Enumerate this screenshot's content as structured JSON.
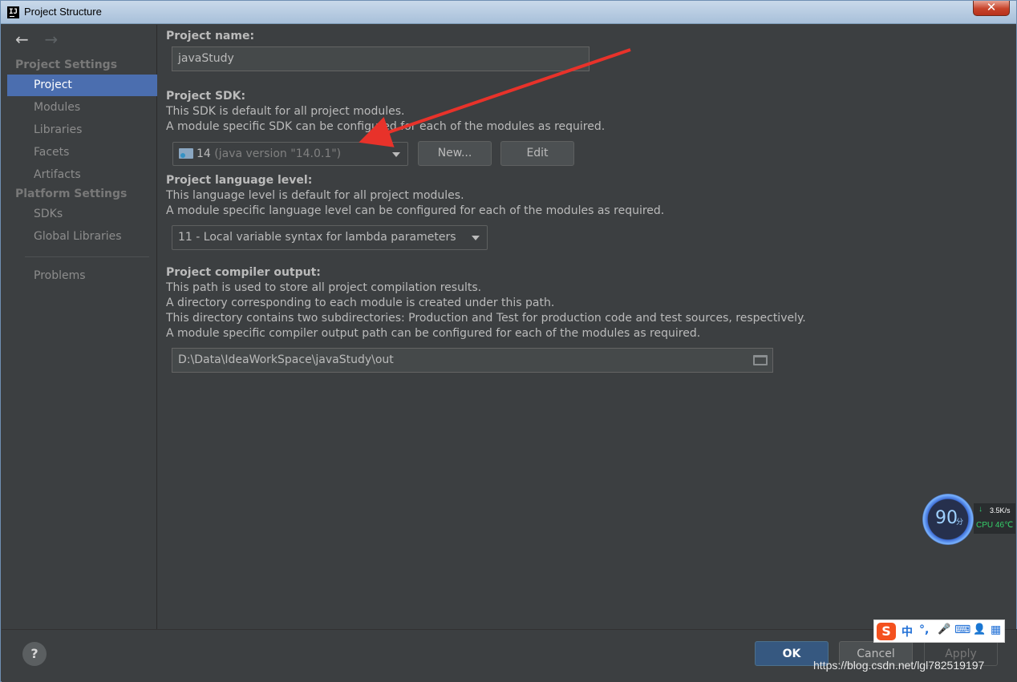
{
  "window": {
    "title": "Project Structure",
    "close": "✕"
  },
  "sidebar": {
    "back": "←",
    "forward": "→",
    "project_settings_header": "Project Settings",
    "project_settings_items": [
      "Project",
      "Modules",
      "Libraries",
      "Facets",
      "Artifacts"
    ],
    "platform_settings_header": "Platform Settings",
    "platform_settings_items": [
      "SDKs",
      "Global Libraries"
    ],
    "problems": "Problems",
    "selected": "Project"
  },
  "project_name": {
    "label": "Project name:",
    "value": "javaStudy"
  },
  "project_sdk": {
    "label": "Project SDK:",
    "desc1": "This SDK is default for all project modules.",
    "desc2": "A module specific SDK can be configured for each of the modules as required.",
    "sdk_name": "14",
    "sdk_version": "(java version \"14.0.1\")",
    "new_button": "New...",
    "edit_button": "Edit"
  },
  "language_level": {
    "label": "Project language level:",
    "desc1": "This language level is default for all project modules.",
    "desc2": "A module specific language level can be configured for each of the modules as required.",
    "value": "11 - Local variable syntax for lambda parameters"
  },
  "compiler_output": {
    "label": "Project compiler output:",
    "desc1": "This path is used to store all project compilation results.",
    "desc2": "A directory corresponding to each module is created under this path.",
    "desc3": "This directory contains two subdirectories: Production and Test for production code and test sources, respectively.",
    "desc4": "A module specific compiler output path can be configured for each of the modules as required.",
    "path": "D:\\Data\\IdeaWorkSpace\\javaStudy\\out"
  },
  "footer": {
    "help": "?",
    "ok": "OK",
    "cancel": "Cancel",
    "apply": "Apply",
    "watermark": "https://blog.csdn.net/lgl782519197"
  },
  "widget": {
    "score": "90",
    "score_unit": "分",
    "net_arrow": "↓",
    "net_speed": "3.5K/s",
    "cpu": "CPU 46℃"
  },
  "ime": {
    "logo": "S",
    "items": [
      "中",
      "°,",
      "🎤",
      "⌨",
      "👤",
      "▦"
    ]
  },
  "colors": {
    "background": "#3c3f41",
    "selection": "#4b6eaf",
    "ok_button": "#365880",
    "annotation_arrow": "#e8322a"
  }
}
